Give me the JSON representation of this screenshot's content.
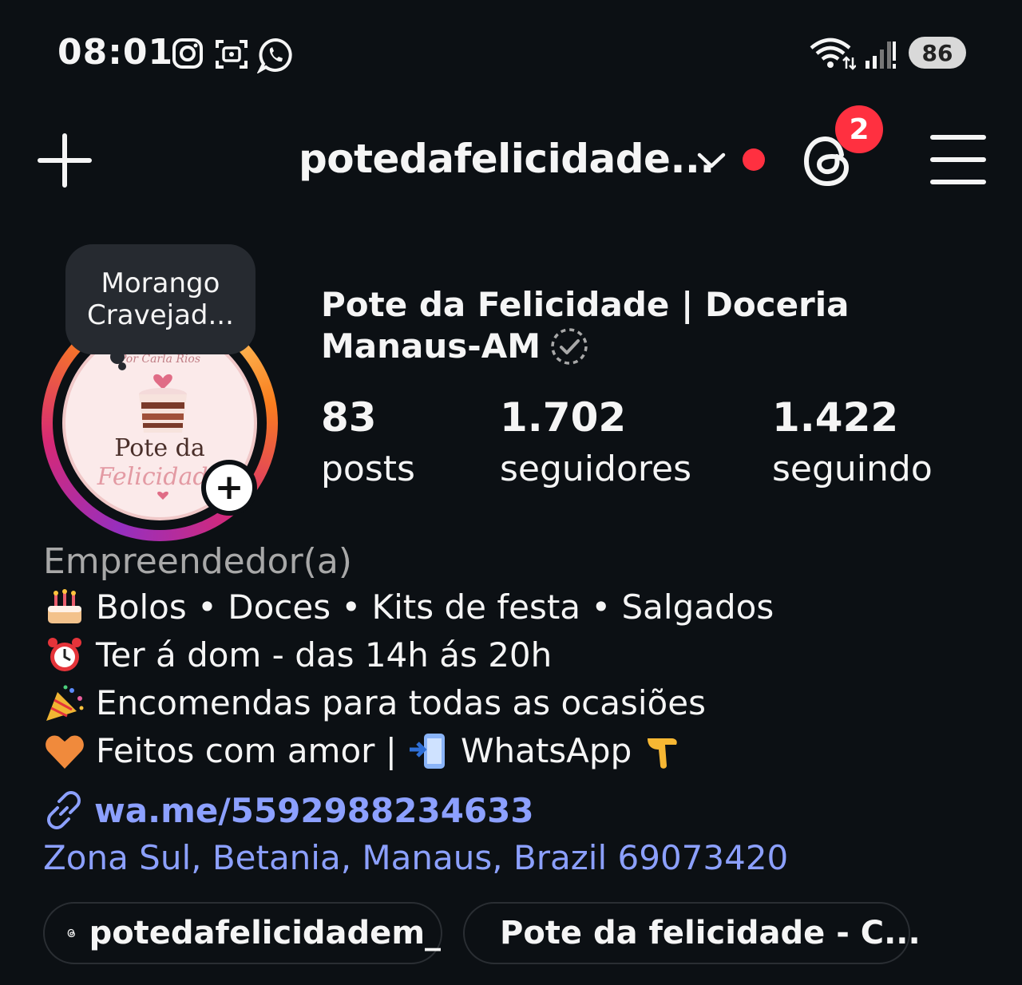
{
  "status_bar": {
    "time": "08:01",
    "battery": "86",
    "icons": [
      "instagram-icon",
      "screenshot-icon",
      "whatsapp-icon",
      "wifi-icon",
      "signal-icon"
    ]
  },
  "header": {
    "username": "potedafelicidade...",
    "notification_count": "2"
  },
  "profile": {
    "note_line1": "Morango",
    "note_line2": "Cravejad...",
    "logo_text_top": "Por Carla Rios",
    "logo_text_line1": "Pote da",
    "logo_text_line2": "Felicidade",
    "name_line1": "Pote da Felicidade | Doceria",
    "name_line2": "Manaus-AM"
  },
  "stats": {
    "posts_count": "83",
    "posts_label": "posts",
    "followers_count": "1.702",
    "followers_label": "seguidores",
    "following_count": "1.422",
    "following_label": "seguindo"
  },
  "bio": {
    "category": "Empreendedor(a)",
    "line1": "Bolos • Doces • Kits de festa • Salgados",
    "line2": "Ter á dom - das 14h ás 20h",
    "line3": "Encomendas para todas as ocasiões",
    "line4_a": "Feitos com amor |",
    "line4_b": "WhatsApp",
    "link": "wa.me/5592988234633",
    "address": "Zona Sul, Betania, Manaus, Brazil 69073420"
  },
  "links": {
    "threads_label": "potedafelicidadem_",
    "facebook_label": "Pote da felicidade - C..."
  },
  "colors": {
    "background": "#0c1014",
    "link_blue": "#8ca0ff",
    "badge_red": "#ff3040"
  }
}
